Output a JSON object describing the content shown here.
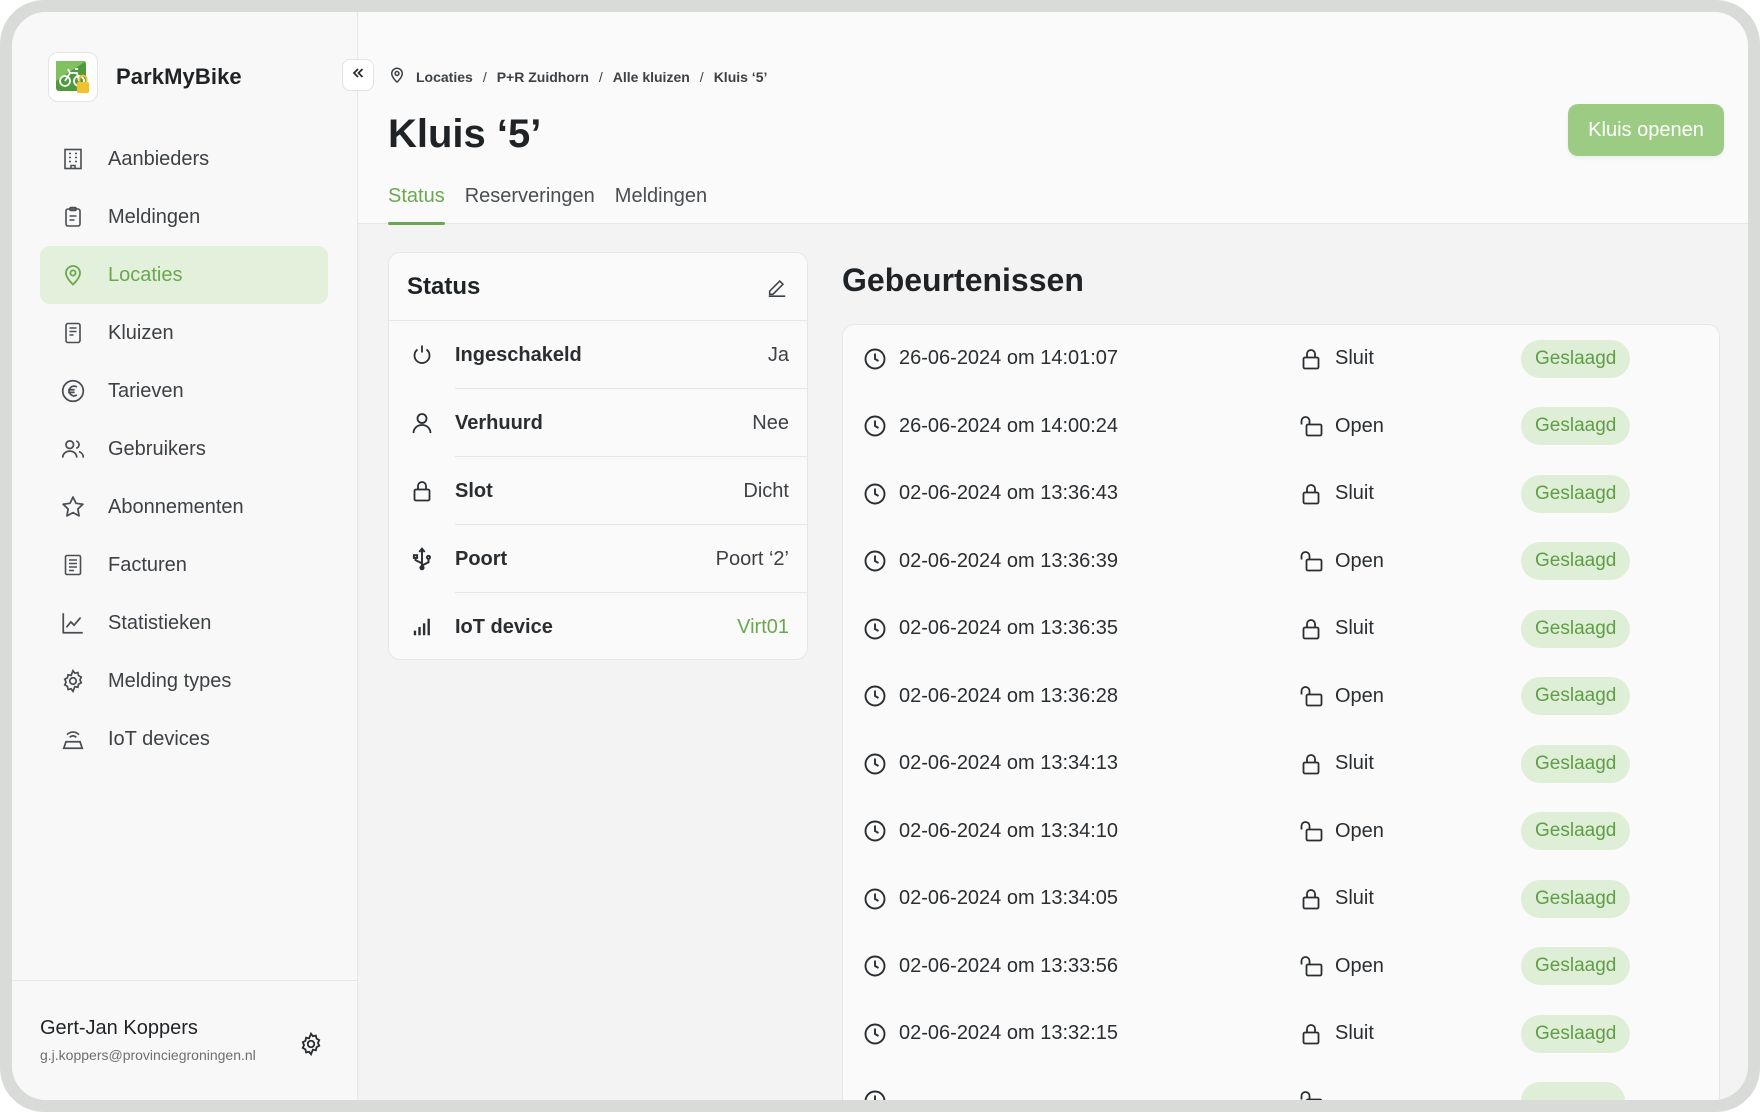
{
  "app": {
    "name": "ParkMyBike",
    "brand_color": "#6aa84f"
  },
  "sidebar": {
    "items": [
      {
        "label": "Aanbieders",
        "icon": "building-icon"
      },
      {
        "label": "Meldingen",
        "icon": "clipboard-icon"
      },
      {
        "label": "Locaties",
        "icon": "location-pin-icon",
        "active": true
      },
      {
        "label": "Kluizen",
        "icon": "locker-icon"
      },
      {
        "label": "Tarieven",
        "icon": "euro-icon"
      },
      {
        "label": "Gebruikers",
        "icon": "users-icon"
      },
      {
        "label": "Abonnementen",
        "icon": "star-icon"
      },
      {
        "label": "Facturen",
        "icon": "invoice-icon"
      },
      {
        "label": "Statistieken",
        "icon": "chart-line-icon"
      },
      {
        "label": "Melding types",
        "icon": "gear-icon"
      },
      {
        "label": "IoT devices",
        "icon": "iot-device-icon"
      }
    ],
    "user": {
      "name": "Gert-Jan Koppers",
      "email": "g.j.koppers@provinciegroningen.nl"
    }
  },
  "header": {
    "breadcrumb": [
      "Locaties",
      "P+R Zuidhorn",
      "Alle kluizen",
      "Kluis ‘5’"
    ],
    "title": "Kluis ‘5’",
    "open_button": "Kluis openen",
    "tabs": [
      {
        "label": "Status",
        "active": true
      },
      {
        "label": "Reserveringen"
      },
      {
        "label": "Meldingen"
      }
    ]
  },
  "status": {
    "title": "Status",
    "rows": [
      {
        "key": "Ingeschakeld",
        "value": "Ja",
        "icon": "power-icon"
      },
      {
        "key": "Verhuurd",
        "value": "Nee",
        "icon": "person-icon"
      },
      {
        "key": "Slot",
        "value": "Dicht",
        "icon": "lock-icon"
      },
      {
        "key": "Poort",
        "value": "Poort ‘2’",
        "icon": "usb-port-icon"
      },
      {
        "key": "IoT device",
        "value": "Virt01",
        "icon": "signal-bars-icon",
        "link": true
      }
    ]
  },
  "events": {
    "title": "Gebeurtenissen",
    "rows": [
      {
        "datetime": "26-06-2024 om 14:01:07",
        "action": "Sluit",
        "status": "Geslaagd"
      },
      {
        "datetime": "26-06-2024 om 14:00:24",
        "action": "Open",
        "status": "Geslaagd"
      },
      {
        "datetime": "02-06-2024 om 13:36:43",
        "action": "Sluit",
        "status": "Geslaagd"
      },
      {
        "datetime": "02-06-2024 om 13:36:39",
        "action": "Open",
        "status": "Geslaagd"
      },
      {
        "datetime": "02-06-2024 om 13:36:35",
        "action": "Sluit",
        "status": "Geslaagd"
      },
      {
        "datetime": "02-06-2024 om 13:36:28",
        "action": "Open",
        "status": "Geslaagd"
      },
      {
        "datetime": "02-06-2024 om 13:34:13",
        "action": "Sluit",
        "status": "Geslaagd"
      },
      {
        "datetime": "02-06-2024 om 13:34:10",
        "action": "Open",
        "status": "Geslaagd"
      },
      {
        "datetime": "02-06-2024 om 13:34:05",
        "action": "Sluit",
        "status": "Geslaagd"
      },
      {
        "datetime": "02-06-2024 om 13:33:56",
        "action": "Open",
        "status": "Geslaagd"
      },
      {
        "datetime": "02-06-2024 om 13:32:15",
        "action": "Sluit",
        "status": "Geslaagd"
      }
    ]
  }
}
